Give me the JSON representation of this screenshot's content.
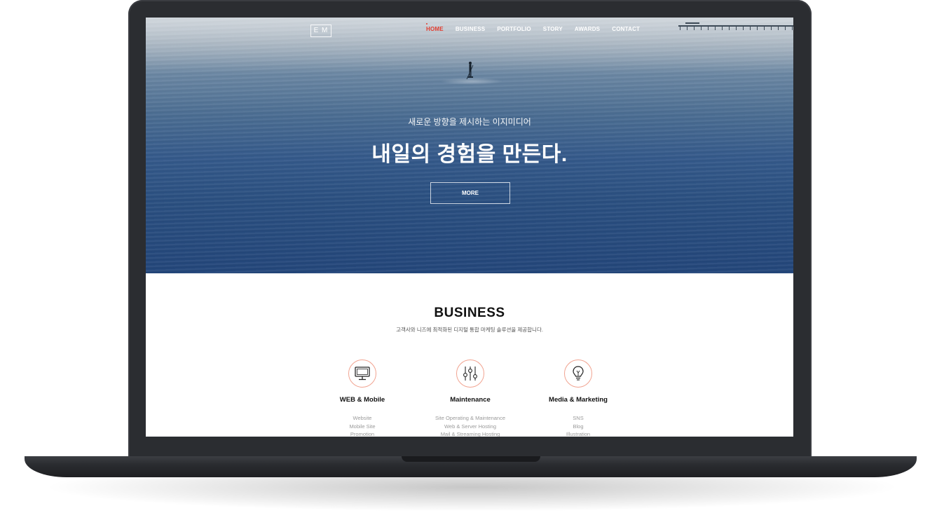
{
  "nav": {
    "logo_text": "E M",
    "items": [
      {
        "label": "HOME",
        "active": true
      },
      {
        "label": "BUSINESS"
      },
      {
        "label": "PORTFOLIO"
      },
      {
        "label": "STORY"
      },
      {
        "label": "AWARDS"
      },
      {
        "label": "CONTACT"
      }
    ]
  },
  "hero": {
    "subtitle": "새로운 방향을 제시하는 이지미디어",
    "title": "내일의 경험을 만든다.",
    "button_label": "MORE"
  },
  "business": {
    "title": "BUSINESS",
    "subtitle": "고객사와 니즈에 최적화된 디지털 통합 마케팅 솔루션을 제공합니다.",
    "services": [
      {
        "icon": "monitor-icon",
        "name": "WEB & Mobile",
        "items": [
          "Website",
          "Mobile Site",
          "Promotion"
        ]
      },
      {
        "icon": "sliders-icon",
        "name": "Maintenance",
        "items": [
          "Site Operating & Maintenance",
          "Web & Server Hosting",
          "Mail & Streaming Hosting"
        ]
      },
      {
        "icon": "lightbulb-icon",
        "name": "Media & Marketing",
        "items": [
          "SNS",
          "Blog",
          "Illustration"
        ]
      }
    ]
  },
  "colors": {
    "accent": "#e33b2d",
    "icon_ring": "#f1a390",
    "frame": "#2b2d31"
  }
}
